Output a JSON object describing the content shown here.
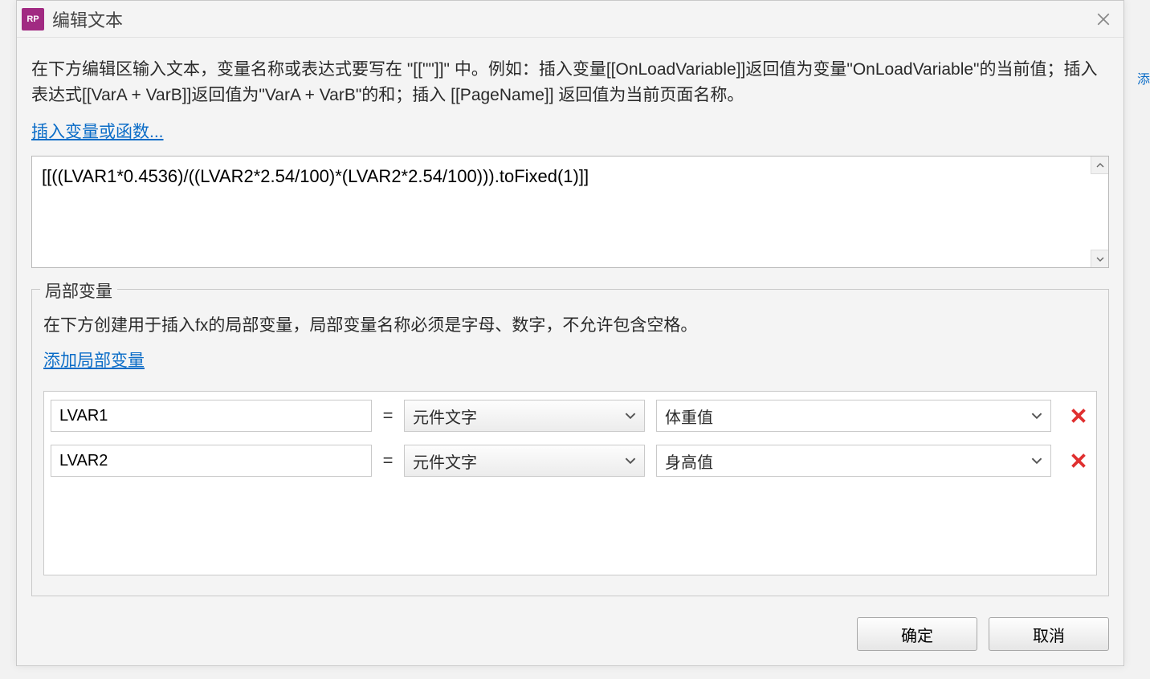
{
  "dialog": {
    "title": "编辑文本",
    "logo_text": "RP",
    "help_text": "在下方编辑区输入文本，变量名称或表达式要写在 \"[[\"\"]]\" 中。例如：插入变量[[OnLoadVariable]]返回值为变量\"OnLoadVariable\"的当前值；插入表达式[[VarA + VarB]]返回值为\"VarA + VarB\"的和；插入 [[PageName]] 返回值为当前页面名称。",
    "insert_link": "插入变量或函数...",
    "expression_value": "[[((LVAR1*0.4536)/((LVAR2*2.54/100)*(LVAR2*2.54/100))).toFixed(1)]]",
    "local_vars": {
      "legend": "局部变量",
      "help": "在下方创建用于插入fx的局部变量，局部变量名称必须是字母、数字，不允许包含空格。",
      "add_link": "添加局部变量",
      "equals": "=",
      "rows": [
        {
          "name": "LVAR1",
          "type_label": "元件文字",
          "widget_label": "体重值"
        },
        {
          "name": "LVAR2",
          "type_label": "元件文字",
          "widget_label": "身高值"
        }
      ]
    },
    "ok_label": "确定",
    "cancel_label": "取消"
  },
  "background": {
    "right_link": "添"
  }
}
